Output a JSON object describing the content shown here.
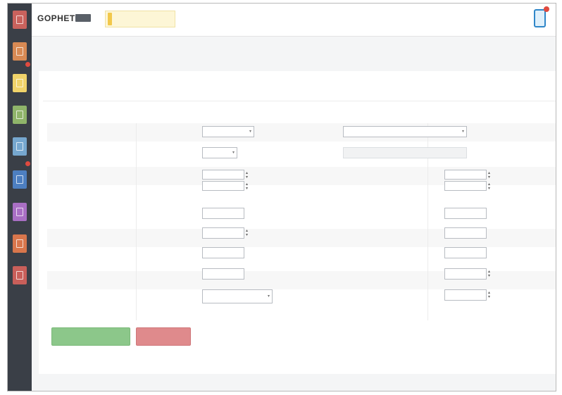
{
  "app": {
    "brand": "GOPHET",
    "brand_badge": "",
    "notice_text": ""
  },
  "rail": {
    "tiles": [
      {
        "color": "#c9625d"
      },
      {
        "color": "#d88a54"
      },
      {
        "color": "#f0d36a"
      },
      {
        "color": "#8fb46a"
      },
      {
        "color": "#76a7cf"
      },
      {
        "color": "#4d7fc1"
      },
      {
        "color": "#a96fc4"
      },
      {
        "color": "#d8764c"
      },
      {
        "color": "#c95f5a"
      }
    ],
    "footer": ""
  },
  "breadcrumb": [
    "",
    "",
    "",
    ""
  ],
  "subtabs": [
    "",
    ""
  ],
  "section_title": "",
  "form": {
    "left": [
      {
        "label": "",
        "value": ""
      },
      {
        "label": "",
        "value": ""
      },
      {
        "label": "",
        "value_a": "",
        "value_b": ""
      },
      {
        "label": "",
        "value": ""
      },
      {
        "label": "",
        "value": ""
      },
      {
        "label": "",
        "value": ""
      },
      {
        "label": "",
        "value": ""
      },
      {
        "label": "",
        "value": ""
      }
    ],
    "right": [
      {
        "label": "",
        "value": ""
      },
      {
        "label": "",
        "value": ""
      },
      {
        "label": "",
        "value_a": "",
        "value_b": ""
      },
      {
        "label": "",
        "value": ""
      },
      {
        "label": "",
        "value": ""
      },
      {
        "label": "",
        "value": ""
      },
      {
        "label": "",
        "value": ""
      },
      {
        "label": "",
        "value": ""
      }
    ]
  },
  "buttons": {
    "save": "",
    "cancel": ""
  },
  "colors": {
    "save": "#8cc78a",
    "cancel": "#df8a8c",
    "accent": "#2f86c8"
  }
}
